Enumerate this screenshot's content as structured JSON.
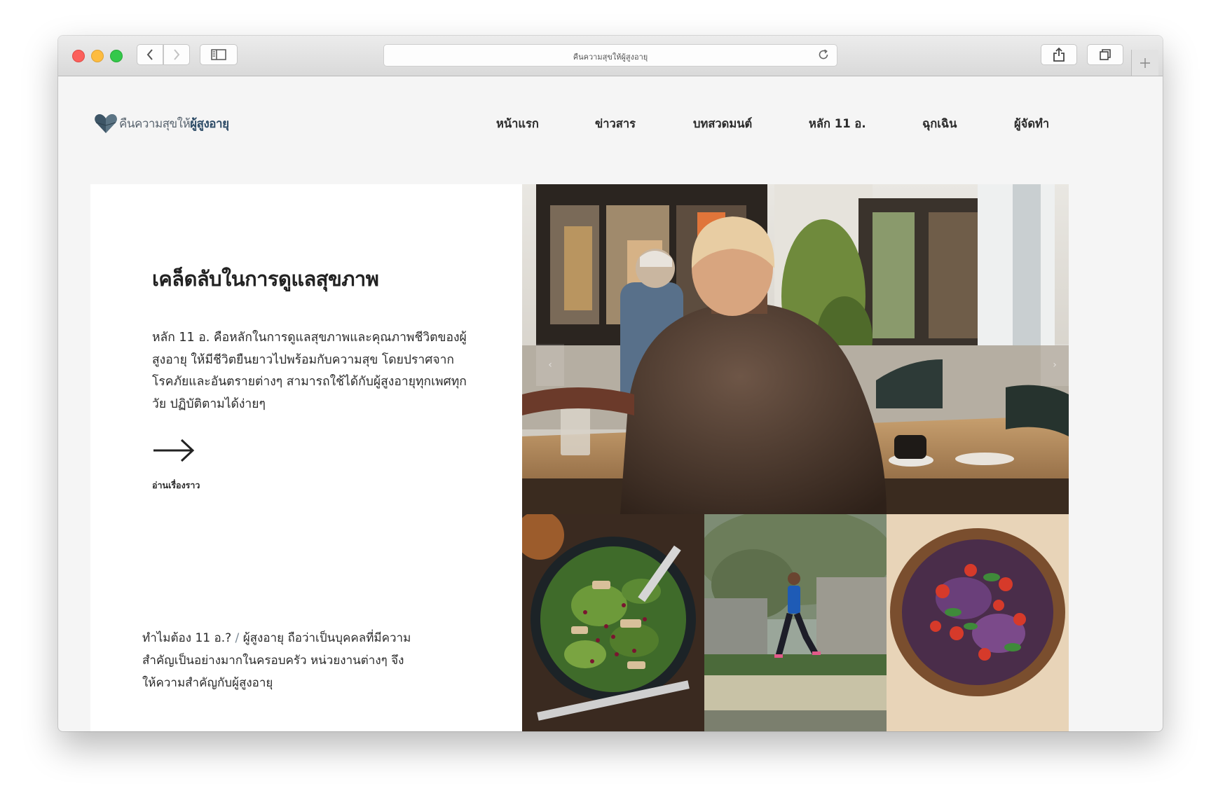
{
  "browser": {
    "url": "คืนความสุขให้ผู้สูงอายุ"
  },
  "site": {
    "logo_text_a": "คืนความสุขให้",
    "logo_text_b": "ผู้สูงอายุ",
    "nav": [
      {
        "label": "หน้าแรก"
      },
      {
        "label": "ข่าวสาร"
      },
      {
        "label": "บทสวดมนต์"
      },
      {
        "label": "หลัก 11 อ."
      },
      {
        "label": "ฉุกเฉิน"
      },
      {
        "label": "ผู้จัดทำ"
      }
    ]
  },
  "hero": {
    "title": "เคล็ดลับในการดูแลสุขภาพ",
    "paragraph": "หลัก 11 อ. คือหลักในการดูแลสุขภาพและคุณภาพชีวิตของผู้สูงอายุ ให้มีชีวิตยืนยาวไปพร้อมกับความสุข โดยปราศจากโรคภัยและอันตรายต่างๆ สามารถใช้ได้กับผู้สูงอายุทุกเพศทุกวัย ปฏิบัติตามได้ง่ายๆ",
    "read_more": "อ่านเรื่องราว",
    "slide_prev": "‹",
    "slide_next": "›"
  },
  "why": {
    "lead": "ทำไมต้อง 11 อ.?",
    "slash": " / ",
    "body": "ผู้สูงอายุ ถือว่าเป็นบุคคลที่มีความสำคัญเป็นอย่างมากในครอบครัว หน่วยงานต่างๆ จึงให้ความสำคัญกับผู้สูงอายุ"
  },
  "colors": {
    "logo_heart": "#3d5566",
    "text": "#2b2b2b",
    "page_bg": "#f5f5f5"
  }
}
